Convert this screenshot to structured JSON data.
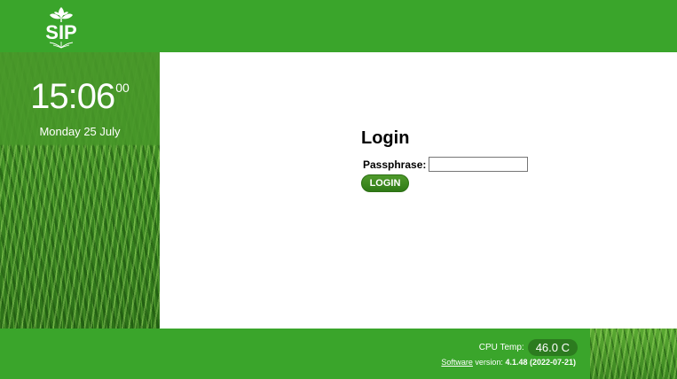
{
  "header": {
    "logo_text": "SIP",
    "logo_icon": "sprout-logo-icon"
  },
  "sidebar": {
    "time_hm": "15:06",
    "time_sec": "00",
    "date": "Monday 25 July"
  },
  "login": {
    "title": "Login",
    "passphrase_label": "Passphrase:",
    "passphrase_value": "",
    "button_label": "LOGIN"
  },
  "footer": {
    "cpu_label": "CPU Temp:",
    "cpu_value": "46.0 C",
    "software_link": "Software",
    "version_label": " version: ",
    "version_value": "4.1.48 (2022-07-21)"
  },
  "colors": {
    "brand_green": "#3aa52b",
    "button_green": "#2f7a16"
  }
}
